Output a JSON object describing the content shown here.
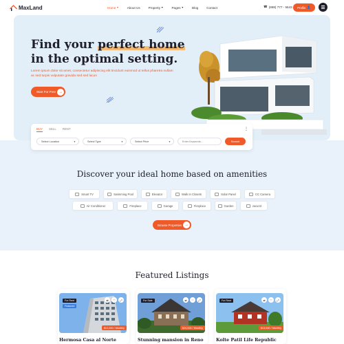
{
  "header": {
    "logo_text": "MaxLand",
    "nav": [
      {
        "label": "Home",
        "has_dropdown": true,
        "active": true
      },
      {
        "label": "About Us",
        "has_dropdown": false,
        "active": false
      },
      {
        "label": "Property",
        "has_dropdown": true,
        "active": false
      },
      {
        "label": "Pages",
        "has_dropdown": true,
        "active": false
      },
      {
        "label": "Blog",
        "has_dropdown": false,
        "active": false
      },
      {
        "label": "Contact",
        "has_dropdown": false,
        "active": false
      }
    ],
    "phone": "(888) 777 - 5643",
    "profile_label": "Profile"
  },
  "hero": {
    "title_part1": "Find your",
    "title_highlight": "perfect home",
    "title_part2": "in the optimal setting.",
    "description": "Lorem ipsum dolor sit amet, consectetur adipiscing elit tincidunt euismod ut tellus pharetra nullam ac sed turpis vulputate gravida sed sed lacus",
    "cta_label": "Start For Free"
  },
  "search": {
    "tabs": [
      "BUY",
      "SELL",
      "RENT"
    ],
    "active_tab": "BUY",
    "location_placeholder": "Select Location",
    "type_placeholder": "Select Type",
    "price_placeholder": "Select Price",
    "keyword_placeholder": "Enter Keywords...",
    "button_label": "Search"
  },
  "amenities": {
    "title": "Discover your ideal home based on amenities",
    "items_row1": [
      "Smart TV",
      "Swimming Pool",
      "Elevator",
      "Walk In Closets",
      "Solar Panel",
      "CC Camera"
    ],
    "items_row2": [
      "Air Conditioner",
      "Fireplace",
      "Garage",
      "Fireplace",
      "Garden",
      "Jacuzzi"
    ],
    "browse_label": "Browse Properties"
  },
  "featured": {
    "title": "Featured Listings",
    "cards": [
      {
        "status": "For Rent",
        "tag": "Featured",
        "price": "$12,000 / Monthly",
        "title": "Hermosa Casa al Norte"
      },
      {
        "status": "For Sale",
        "tag": "",
        "price": "$24,000 / Monthly",
        "title": "Stunning mansion in Reno"
      },
      {
        "status": "For Rent",
        "tag": "",
        "price": "$13,000 / Monthly",
        "title": "Kolte Patil Life Republic"
      }
    ]
  },
  "colors": {
    "accent": "#f05a28",
    "hero_bg": "#e2eef8",
    "dark": "#1e1e2d"
  }
}
